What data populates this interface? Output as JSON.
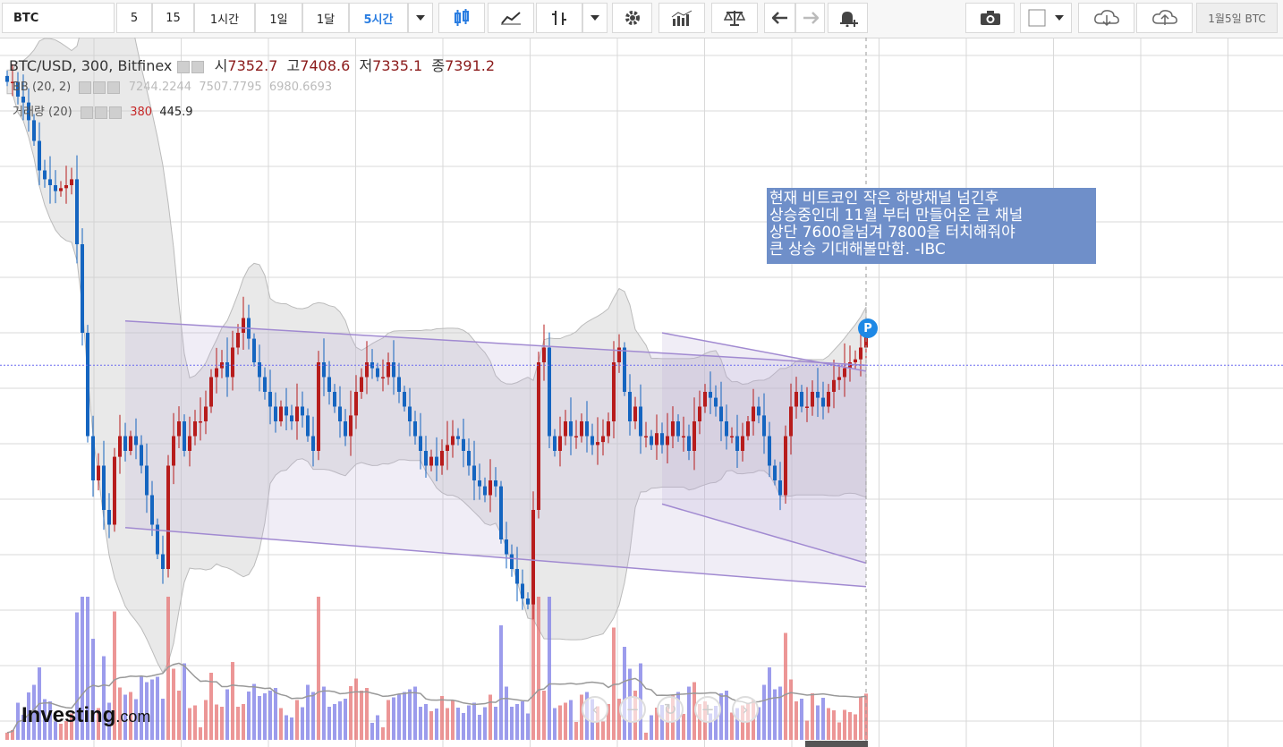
{
  "toolbar": {
    "symbol": "BTC",
    "intervals": [
      "5",
      "15",
      "1시간",
      "1일",
      "1달",
      "5시간"
    ],
    "active_interval": "5시간",
    "date_button": "1월5일 BTC"
  },
  "legend": {
    "series_title": "BTC/USD, 300, Bitfinex",
    "open_label": "시",
    "open_value": "7352.7",
    "high_label": "고",
    "high_value": "7408.6",
    "low_label": "저",
    "low_value": "7335.1",
    "close_label": "종",
    "close_value": "7391.2",
    "bb_label": "BB (20, 2)",
    "bb_values": [
      "7244.2244",
      "7507.7795",
      "6980.6693"
    ],
    "volume_label": "거래량 (20)",
    "volume_value": "380",
    "volume_ma": "445.9"
  },
  "annotation": {
    "lines": [
      "현재 비트코인 작은 하방채널 넘긴후",
      "상승중인데 11월 부터 만들어온 큰 채널",
      "상단 7600을넘겨 7800을 터치해줘야",
      "큰 상승 기대해볼만함. -IBC"
    ],
    "marker": "P"
  },
  "logo": {
    "main": "Investing",
    "suffix": ".com"
  },
  "colors": {
    "up": "#b71c1c",
    "down": "#1565c0",
    "channel": "#a18ad1",
    "note_bg": "#6f8fc9"
  },
  "chart_data": {
    "type": "candlestick",
    "title": "BTC/USD, 300, Bitfinex",
    "ylim": [
      6400,
      8400
    ],
    "x_bars": 161,
    "close": [
      8250,
      8250,
      8200,
      8180,
      8120,
      8050,
      7950,
      7920,
      7900,
      7880,
      7890,
      7900,
      7920,
      7700,
      7400,
      7050,
      6900,
      6950,
      6800,
      6750,
      6980,
      7050,
      7000,
      7050,
      7020,
      6950,
      6850,
      6750,
      6650,
      6600,
      6950,
      7050,
      7100,
      7000,
      7050,
      7100,
      7100,
      7150,
      7250,
      7280,
      7300,
      7250,
      7350,
      7400,
      7450,
      7380,
      7300,
      7250,
      7200,
      7150,
      7100,
      7150,
      7120,
      7100,
      7150,
      7120,
      7050,
      7000,
      7300,
      7250,
      7200,
      7150,
      7100,
      7050,
      7120,
      7200,
      7250,
      7300,
      7280,
      7250,
      7250,
      7300,
      7250,
      7200,
      7150,
      7100,
      7050,
      7000,
      6950,
      6980,
      6950,
      7000,
      7020,
      7050,
      7040,
      7000,
      6950,
      6900,
      6880,
      6850,
      6900,
      6880,
      6700,
      6650,
      6600,
      6550,
      6500,
      6480,
      6800,
      7300,
      7350,
      7050,
      7000,
      7050,
      7100,
      7050,
      7050,
      7100,
      7050,
      7020,
      7030,
      7050,
      7100,
      7300,
      7350,
      7200,
      7100,
      7150,
      7050,
      7050,
      7020,
      7060,
      7020,
      7050,
      7100,
      7050,
      7050,
      7000,
      7100,
      7150,
      7200,
      7180,
      7150,
      7100,
      7050,
      7050,
      7000,
      7050,
      7100,
      7150,
      7120,
      7050,
      6950,
      6900,
      6850,
      7050,
      7150,
      7200,
      7150,
      7150,
      7200,
      7180,
      7150,
      7200,
      7240,
      7250,
      7280,
      7300,
      7310,
      7350,
      7391.2
    ],
    "channels": [
      {
        "name": "large_channel_upper",
        "x": [
          22,
          160
        ],
        "y": [
          7440,
          7290
        ]
      },
      {
        "name": "large_channel_lower",
        "x": [
          22,
          160
        ],
        "y": [
          6740,
          6540
        ]
      },
      {
        "name": "small_channel_upper",
        "x": [
          122,
          160
        ],
        "y": [
          7400,
          7270
        ]
      },
      {
        "name": "small_channel_lower",
        "x": [
          122,
          160
        ],
        "y": [
          6820,
          6620
        ]
      }
    ],
    "price_line": 7290,
    "bollinger": {
      "middle": "7244.2244",
      "upper": "7507.7795",
      "lower": "6980.6693"
    },
    "volume": {
      "last": 380,
      "ma": 445.9
    }
  }
}
